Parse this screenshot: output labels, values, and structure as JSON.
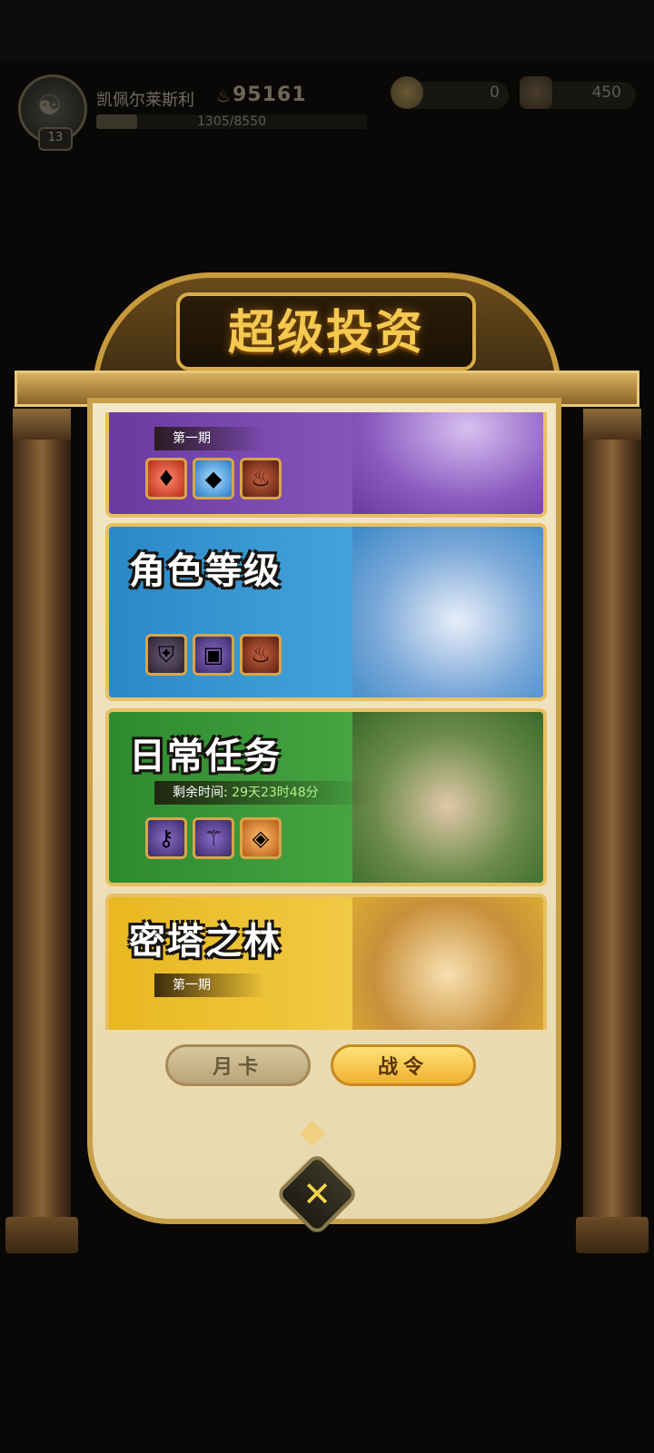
{
  "player": {
    "name": "凯佩尔莱斯利",
    "level": "13",
    "power": "95161",
    "xp_text": "1305/8550",
    "xp_current": 1305,
    "xp_max": 8550
  },
  "currencies": [
    {
      "icon": "gold-coin-icon",
      "value": "0"
    },
    {
      "icon": "trophy-icon",
      "value": "450"
    }
  ],
  "panel": {
    "title": "超级投资"
  },
  "cards": [
    {
      "title": "",
      "subtitle": "第一期",
      "bg": "#7a48b0",
      "art": "tentacle-sorceress",
      "items": [
        "red-gem-icon",
        "blue-crystal-icon",
        "fire-totem-icon"
      ]
    },
    {
      "title": "角色等级",
      "subtitle": "",
      "bg": "#3a9ed8",
      "art": "water-spirit-and-seal",
      "items": [
        "armor-icon",
        "treasure-chest-icon",
        "fire-totem-icon"
      ]
    },
    {
      "title": "日常任务",
      "subtitle_label": "剩余时间:",
      "subtitle_value": "29天23时48分",
      "bg": "#3e9a3a",
      "art": "old-druid",
      "items": [
        "key-icon",
        "staff-icon",
        "amber-crystal-icon"
      ]
    },
    {
      "title": "密塔之林",
      "subtitle": "第一期",
      "bg": "#e8c030",
      "art": "lion-warrior",
      "items": []
    }
  ],
  "buttons": {
    "month_card": "月卡",
    "battle_pass": "战令"
  },
  "colors": {
    "accent_gold": "#f5c850",
    "frame_gold": "#c9a04a"
  }
}
